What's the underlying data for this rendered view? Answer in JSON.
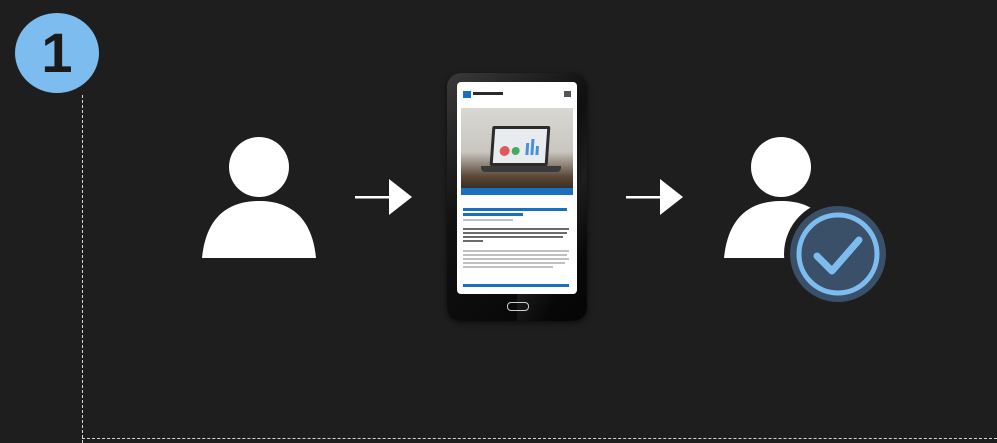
{
  "step": {
    "number": "1",
    "badge_color": "#7dbcef"
  },
  "colors": {
    "background": "#1e1e1e",
    "figure": "#ffffff",
    "dashes": "#d6d6d6",
    "check_badge_fill": "#3a4f68",
    "check_mark": "#7dbcef"
  },
  "icons": [
    "person-icon",
    "arrow-right-icon",
    "smartphone-icon",
    "person-verified-icon",
    "checkmark-circle-icon"
  ]
}
